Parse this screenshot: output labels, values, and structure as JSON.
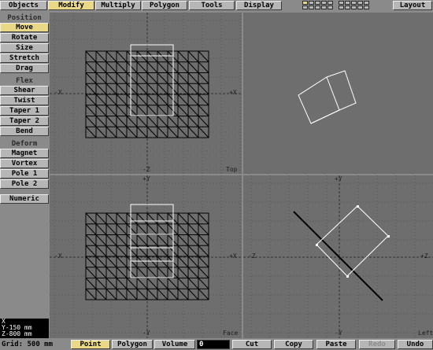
{
  "tabs": [
    {
      "label": "Objects",
      "active": false
    },
    {
      "label": "Modify",
      "active": true
    },
    {
      "label": "Multiply",
      "active": false
    },
    {
      "label": "Polygon",
      "active": false
    },
    {
      "label": "Tools",
      "active": false
    },
    {
      "label": "Display",
      "active": false
    }
  ],
  "layout_button": "Layout",
  "sidebar": {
    "position_label": "Position",
    "position_tools": [
      {
        "label": "Move",
        "active": true
      },
      {
        "label": "Rotate",
        "active": false
      },
      {
        "label": "Size",
        "active": false
      },
      {
        "label": "Stretch",
        "active": false
      },
      {
        "label": "Drag",
        "active": false
      }
    ],
    "flex_label": "Flex",
    "flex_tools": [
      {
        "label": "Shear",
        "active": false
      },
      {
        "label": "Twist",
        "active": false
      },
      {
        "label": "Taper 1",
        "active": false
      },
      {
        "label": "Taper 2",
        "active": false
      },
      {
        "label": "Bend",
        "active": false
      }
    ],
    "deform_label": "Deform",
    "deform_tools": [
      {
        "label": "Magnet",
        "active": false
      },
      {
        "label": "Vortex",
        "active": false
      },
      {
        "label": "Pole 1",
        "active": false
      },
      {
        "label": "Pole 2",
        "active": false
      }
    ],
    "numeric": "Numeric"
  },
  "coords": {
    "x": "X",
    "y": "Y-150 mm",
    "z": "Z-800 mm"
  },
  "viewports": {
    "top": {
      "name": "Top",
      "left": "-X",
      "right": "+X",
      "up": "",
      "down": "-Z"
    },
    "face": {
      "name": "Face",
      "left": "-X",
      "right": "+X",
      "up": "+Y",
      "down": "-Y"
    },
    "left": {
      "name": "Left",
      "left": "-Z",
      "right": "+Z",
      "up": "+Y",
      "down": "-Y"
    },
    "perspective": {
      "name": ""
    }
  },
  "status": {
    "grid": "Grid: 500 mm",
    "modes": [
      {
        "label": "Point",
        "active": true
      },
      {
        "label": "Polygon",
        "active": false
      },
      {
        "label": "Volume",
        "active": false
      }
    ],
    "command_value": "0",
    "edit": [
      {
        "label": "Cut",
        "enabled": true
      },
      {
        "label": "Copy",
        "enabled": true
      },
      {
        "label": "Paste",
        "enabled": true
      },
      {
        "label": "Redo",
        "enabled": false
      },
      {
        "label": "Undo",
        "enabled": true
      }
    ]
  },
  "colors": {
    "active": "#e9d885",
    "button": "#b6b6b6",
    "viewport": "#6e6e6e",
    "panel": "#8a8a8a"
  },
  "icons": {
    "layer_grid": "layer-grid-icon"
  }
}
